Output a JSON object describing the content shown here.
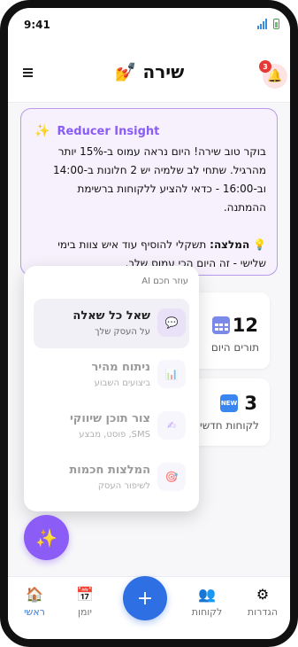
{
  "status_bar": {
    "time": "9:41",
    "signal_icon": "signal-icon",
    "battery_icon": "battery-icon"
  },
  "header": {
    "title": "שירה 💅",
    "menu_icon": "hamburger-menu-icon",
    "notifications_icon": "bell-icon",
    "notification_count": "3"
  },
  "insight": {
    "icon": "sparkle-icon",
    "title": "Reducer Insight",
    "line1": "בוקר טוב שירה! היום נראה עמוס ב-15% יותר מהרגיל. שתחי לב שלמיה יש 2 חלונות ב-14:00 וב-16:00 - כדאי להציע ללקוחות ברשימת ההמתנה.",
    "recommendation_label": "המלצה:",
    "recommendation_text": "תשקלי להוסיף עוד איש צוות בימי שלישי - זה היום הכי עמוס שלך."
  },
  "stats": [
    {
      "value": "12",
      "label": "תורים היום",
      "icon": "calendar-icon"
    },
    {
      "value": "3",
      "label": "לקוחות חדשים",
      "icon": "new-badge-icon",
      "icon_text": "NEW"
    }
  ],
  "ai_popup": {
    "header": "עוזר חכם AI",
    "items": [
      {
        "title": "שאל כל שאלה",
        "subtitle": "על העסק שלך",
        "icon": "speech-bubble-icon",
        "active": true
      },
      {
        "title": "ניתוח מהיר",
        "subtitle": "ביצועים השבוע",
        "icon": "bar-chart-icon",
        "active": false
      },
      {
        "title": "צור תוכן שיווקי",
        "subtitle": "SMS, פוסט, מבצע",
        "icon": "writing-hand-icon",
        "active": false
      },
      {
        "title": "המלצות חכמות",
        "subtitle": "לשיפור העסק",
        "icon": "target-icon",
        "active": false
      }
    ]
  },
  "fab": {
    "icon": "sparkles-icon"
  },
  "tabbar": {
    "tabs": [
      {
        "label": "ראשי",
        "icon": "home-icon",
        "active": true
      },
      {
        "label": "יומן",
        "icon": "calendar-icon",
        "active": false
      },
      {
        "label": "לקוחות",
        "icon": "people-icon",
        "active": false
      },
      {
        "label": "הגדרות",
        "icon": "gear-icon",
        "active": false
      }
    ],
    "plus_label": "+"
  },
  "colors": {
    "accent": "#8b5cf6",
    "primary_blue": "#2f6fe4",
    "badge_red": "#e53935",
    "insight_bg": "#f6f1fc"
  }
}
